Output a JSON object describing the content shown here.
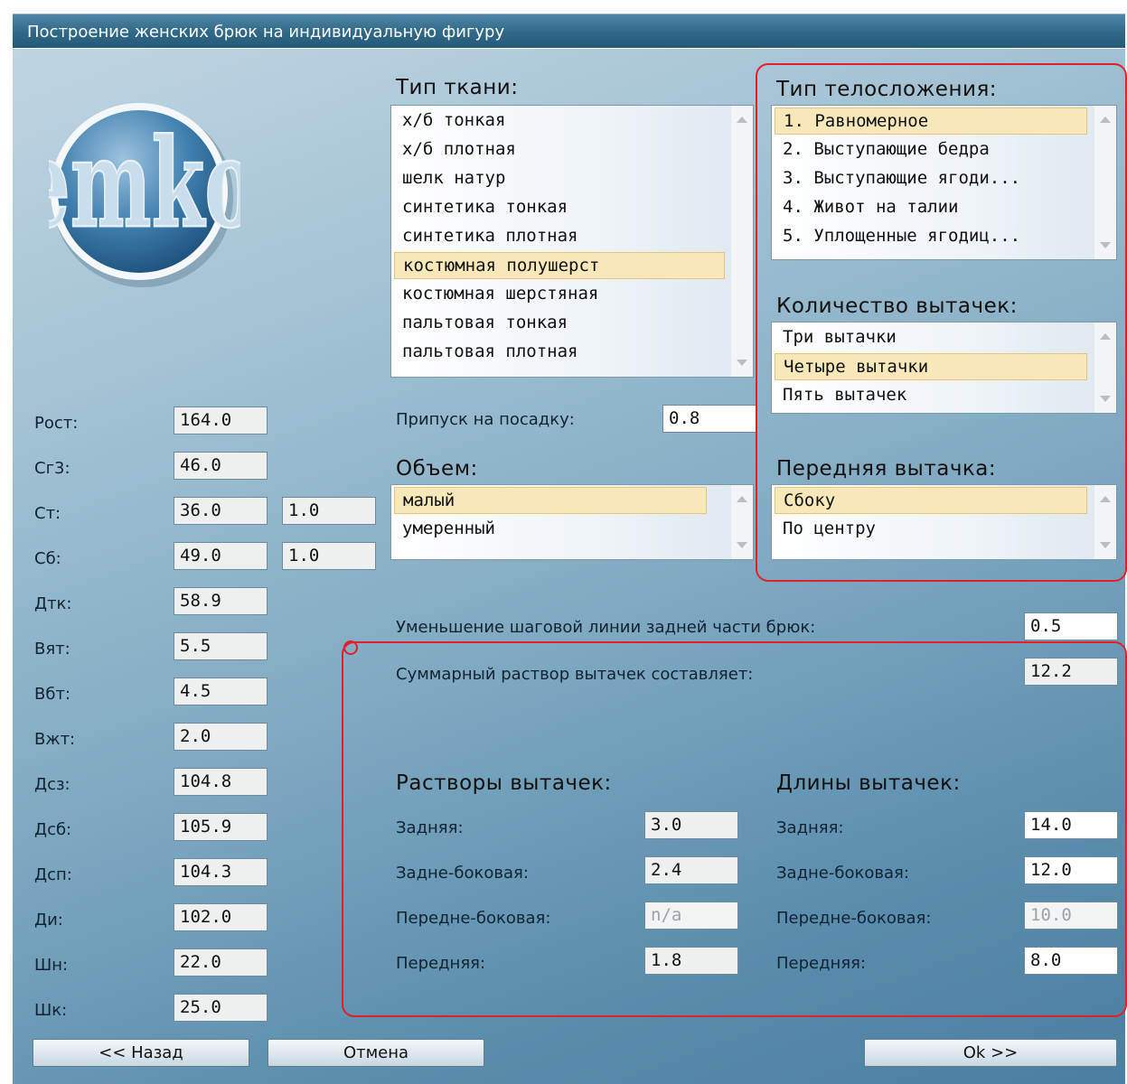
{
  "window": {
    "title": "Построение женских брюк на индивидуальную фигуру"
  },
  "logo": {
    "text": "emko"
  },
  "measurements": [
    {
      "label": "Рост:",
      "value": "164.0"
    },
    {
      "label": "Сг3:",
      "value": "46.0"
    },
    {
      "label": "Ст:",
      "value": "36.0",
      "extra": "1.0"
    },
    {
      "label": "Сб:",
      "value": "49.0",
      "extra": "1.0"
    },
    {
      "label": "Дтк:",
      "value": "58.9"
    },
    {
      "label": "Вят:",
      "value": "5.5"
    },
    {
      "label": "Вбт:",
      "value": "4.5"
    },
    {
      "label": "Вжт:",
      "value": "2.0"
    },
    {
      "label": "Дсз:",
      "value": "104.8"
    },
    {
      "label": "Дсб:",
      "value": "105.9"
    },
    {
      "label": "Дсп:",
      "value": "104.3"
    },
    {
      "label": "Ди:",
      "value": "102.0"
    },
    {
      "label": "Шн:",
      "value": "22.0"
    },
    {
      "label": "Шк:",
      "value": "25.0"
    }
  ],
  "fabric": {
    "heading": "Тип ткани:",
    "items": [
      "х/б тонкая",
      "х/б плотная",
      "шелк натур",
      "синтетика тонкая",
      "синтетика плотная",
      "костюмная полушерст",
      "костюмная шерстяная",
      "пальтовая тонкая",
      "пальтовая плотная"
    ],
    "selected": "костюмная полушерст"
  },
  "allowance": {
    "label": "Припуск на посадку:",
    "value": "0.8"
  },
  "volume": {
    "heading": "Объем:",
    "items": [
      "малый",
      "умеренный"
    ],
    "selected": "малый"
  },
  "body_type": {
    "heading": "Тип телосложения:",
    "items": [
      "1. Равномерное",
      "2. Выступающие бедра",
      "3. Выступающие ягоди...",
      "4. Живот на талии",
      "5. Уплощенные ягодиц..."
    ],
    "selected": "1. Равномерное"
  },
  "dart_count": {
    "heading": "Количество вытачек:",
    "items": [
      "Три вытачки",
      "Четыре вытачки",
      "Пять вытачек"
    ],
    "selected": "Четыре вытачки"
  },
  "front_dart": {
    "heading": "Передняя вытачка:",
    "items": [
      "Сбоку",
      "По центру"
    ],
    "selected": "Сбоку"
  },
  "crotch_reduction": {
    "label": "Уменьшение шаговой линии задней части брюк:",
    "value": "0.5"
  },
  "total_darts": {
    "label": "Суммарный раствор вытачек составляет:",
    "value": "12.2"
  },
  "dart_openings": {
    "heading": "Растворы вытачек:",
    "rows": [
      {
        "label": "Задняя:",
        "value": "3.0"
      },
      {
        "label": "Задне-боковая:",
        "value": "2.4"
      },
      {
        "label": "Передне-боковая:",
        "value": "n/a"
      },
      {
        "label": "Передняя:",
        "value": "1.8"
      }
    ]
  },
  "dart_lengths": {
    "heading": "Длины вытачек:",
    "rows": [
      {
        "label": "Задняя:",
        "value": "14.0"
      },
      {
        "label": "Задне-боковая:",
        "value": "12.0"
      },
      {
        "label": "Передне-боковая:",
        "value": "10.0"
      },
      {
        "label": "Передняя:",
        "value": "8.0"
      }
    ]
  },
  "buttons": {
    "back": "<< Назад",
    "cancel": "Отмена",
    "ok": "Ok >>"
  }
}
